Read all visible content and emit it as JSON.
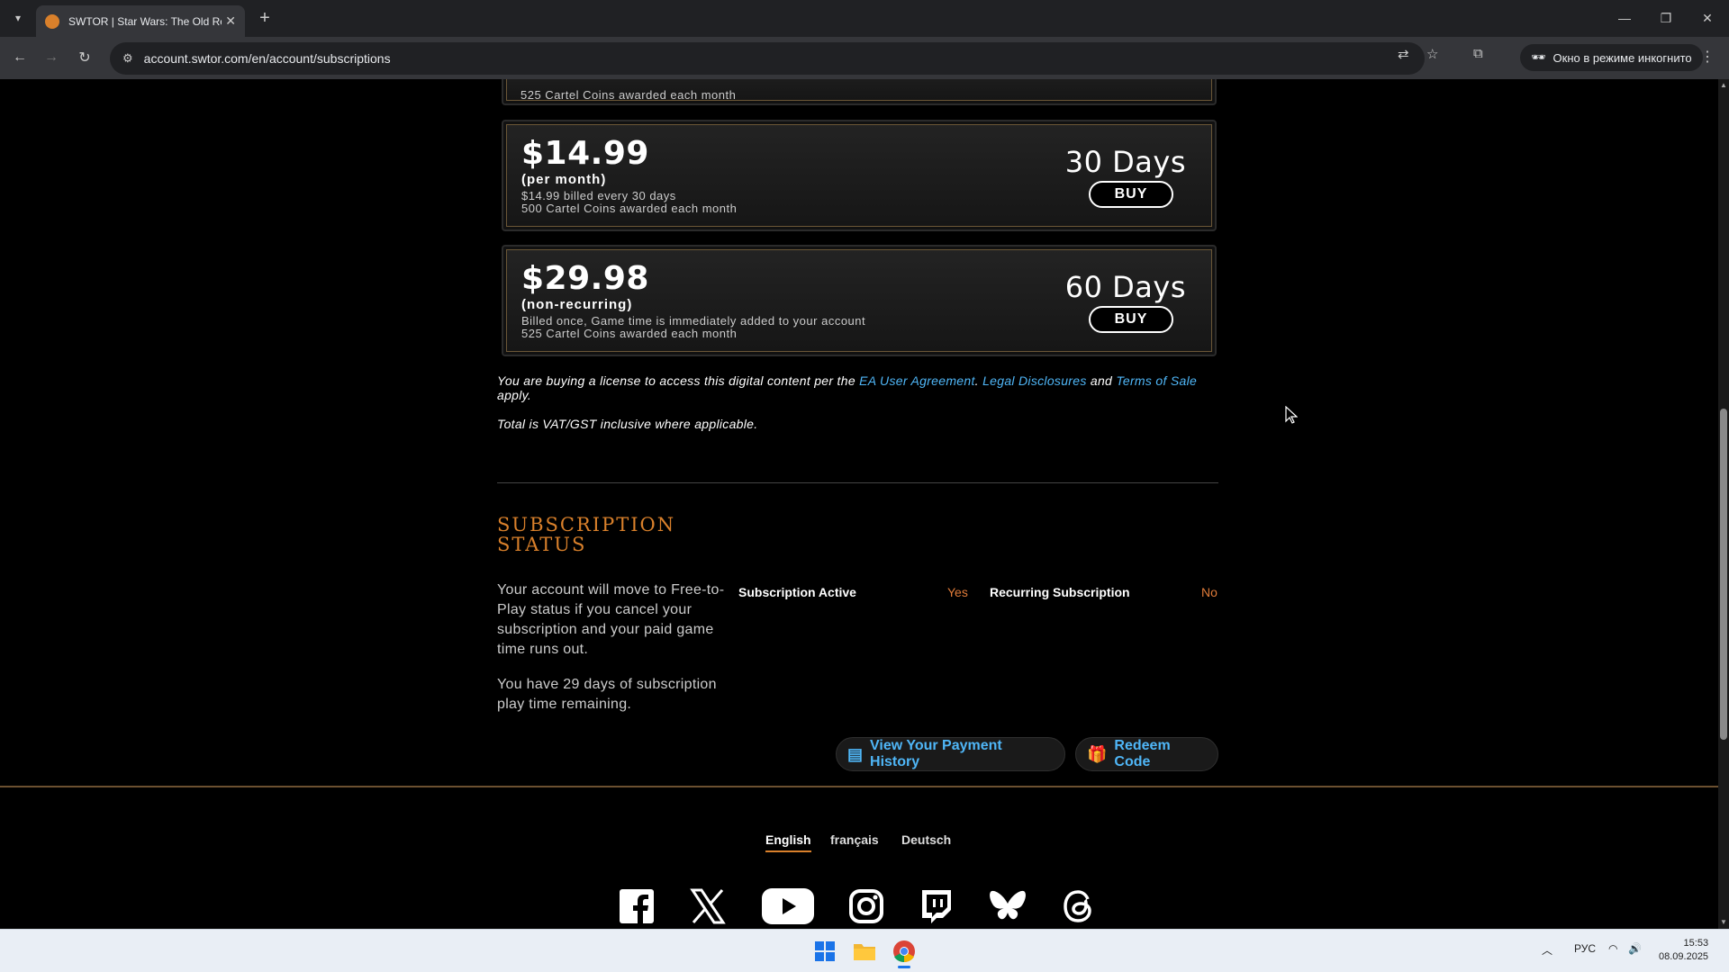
{
  "browser": {
    "tab_title": "SWTOR | Star Wars: The Old Re",
    "url": "account.swtor.com/en/account/subscriptions",
    "incognito_label": "Окно в режиме инкогнито"
  },
  "plans": [
    {
      "price": "$14.99",
      "period": "(per month)",
      "line1": "$14.99 billed every 30 days",
      "line2": "500 Cartel Coins awarded each month",
      "days": "30 Days",
      "buy_label": "BUY"
    },
    {
      "price": "$29.98",
      "period": "(non-recurring)",
      "line1": "Billed once, Game time is immediately added to your account",
      "line2": "525 Cartel Coins awarded each month",
      "days": "60 Days",
      "buy_label": "BUY"
    }
  ],
  "partial_plan": {
    "line2": "525 Cartel Coins awarded each month"
  },
  "legal": {
    "prefix": "You are buying a license to access this digital content per the ",
    "ea_link": "EA User Agreement",
    "sep": ". ",
    "legal_link": "Legal Disclosures",
    "and": " and ",
    "terms_link": "Terms of Sale",
    "suffix": " apply.",
    "vat": "Total is VAT/GST inclusive where applicable."
  },
  "status": {
    "title": "SUBSCRIPTION STATUS",
    "text1": "Your account will move to Free-to-Play status if you cancel your subscription and your paid game time runs out.",
    "text2": "You have 29 days of subscription play time remaining.",
    "active_label": "Subscription Active",
    "active_value": "Yes",
    "recurring_label": "Recurring Subscription",
    "recurring_value": "No"
  },
  "actions": {
    "payment_history": "View Your Payment History",
    "redeem": "Redeem Code"
  },
  "footer": {
    "languages": [
      "English",
      "français",
      "Deutsch"
    ],
    "socials": [
      "facebook-icon",
      "x-icon",
      "youtube-icon",
      "instagram-icon",
      "twitch-icon",
      "bluesky-icon",
      "threads-icon"
    ]
  },
  "taskbar": {
    "lang": "РУС",
    "time": "15:53",
    "date": "08.09.2025"
  },
  "colors": {
    "accent_orange": "#d9802b",
    "link_blue": "#4fb6f7",
    "status_value": "#e07b39"
  }
}
